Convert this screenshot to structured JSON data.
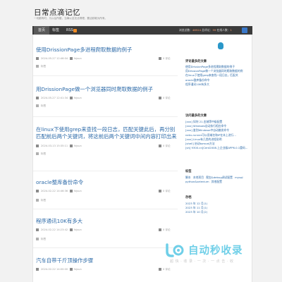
{
  "site": {
    "title": "日常点滴记忆",
    "description": "一切都有时，凡以后所做，当事以全无法得理，要活跃敢为所有。"
  },
  "nav": {
    "home": "首页",
    "tags": "标签",
    "rss": "RSS",
    "stats_prefix": "浏览总数：",
    "stats_views": "48524",
    "stats_mid": " 总评论：",
    "stats_comments": "59",
    "stats_mid2": " 在线人数：",
    "stats_online": "1"
  },
  "posts": [
    {
      "title": "使用DrissionPage多进程爬取数据的例子",
      "date": "2024-05-27 12:46:04",
      "author": "fxjsun",
      "comments": "0 评论",
      "tag": "标签"
    },
    {
      "title": "用DrissionPage做一个浏览器同时爬取数据的例子",
      "date": "2024-05-27 12:41:34",
      "author": "fxjsun",
      "comments": "0 评论",
      "tag": "标签"
    },
    {
      "title": "在linux下使用grep来查找一段日志，匹配关键此后，再分别匹配前后两个关键词，将这前后两个关键词中间内容打印出来",
      "date": "2024-03-13 15:35:11",
      "author": "fxjsun",
      "comments": "0 评论",
      "tag": "标签"
    },
    {
      "title": "oracle整库备份命令",
      "date": "2024-02-22 14:46:36",
      "author": "fxjsun",
      "comments": "0 评论",
      "tag": "标签"
    },
    {
      "title": "程序通讯10K有多大",
      "date": "2024-02-22 14:23:42",
      "author": "fxjsun",
      "comments": "0 评论",
      "tag": "标签"
    },
    {
      "title": "汽车自带千斤顶操作步骤",
      "date": "2024-02-22 14:00:00",
      "author": "fxjsun",
      "comments": "0 评论",
      "tag": "标签"
    }
  ],
  "sidebar": {
    "recent_title": "评论最多的文章",
    "recent": [
      "使用DrissionPage多进程爬取数据的例子",
      "用DrissionPage做一个浏览器同时爬取数据的例",
      "在linux下使用grep来查找一段日志，匹配关",
      "oracle整库备份命令",
      "程序通讯10K有多大"
    ],
    "visited_title": "访问最多的文章",
    "visited": [
      "[xxx] 如何 21.金城等中级配置",
      "[xxx] Windows自动执行相应命令",
      "[xxx] 鉴别Windows中自动触发命令",
      "nekv-runner可以用域名和IP在本上进行...",
      "[xxx] Linux有几类的进程说明",
      "[shell] 启动tomcat方法",
      "[sh] 9300.cn]Cent2008.上企业级APP6.0.1重码..."
    ],
    "tags_title": "标签",
    "tags": [
      "脚本",
      "本地项目",
      "爬虫&debug调试配置",
      "mysql",
      "python&selenium",
      "其他配置"
    ],
    "archive_title": "存档",
    "archive": [
      "2023 年 12 月(1)",
      "2023 年 11 月(1)",
      "2023 年 10 月(2)"
    ]
  },
  "watermark": {
    "text": "自动秒收录",
    "sub": "超 快 · 收 录 · 一 次 · 一 点 击 · 收"
  },
  "colors": {
    "link": "#2c6aa8",
    "nav_bg": "#3b3b3b",
    "rss": "#f38b23"
  }
}
